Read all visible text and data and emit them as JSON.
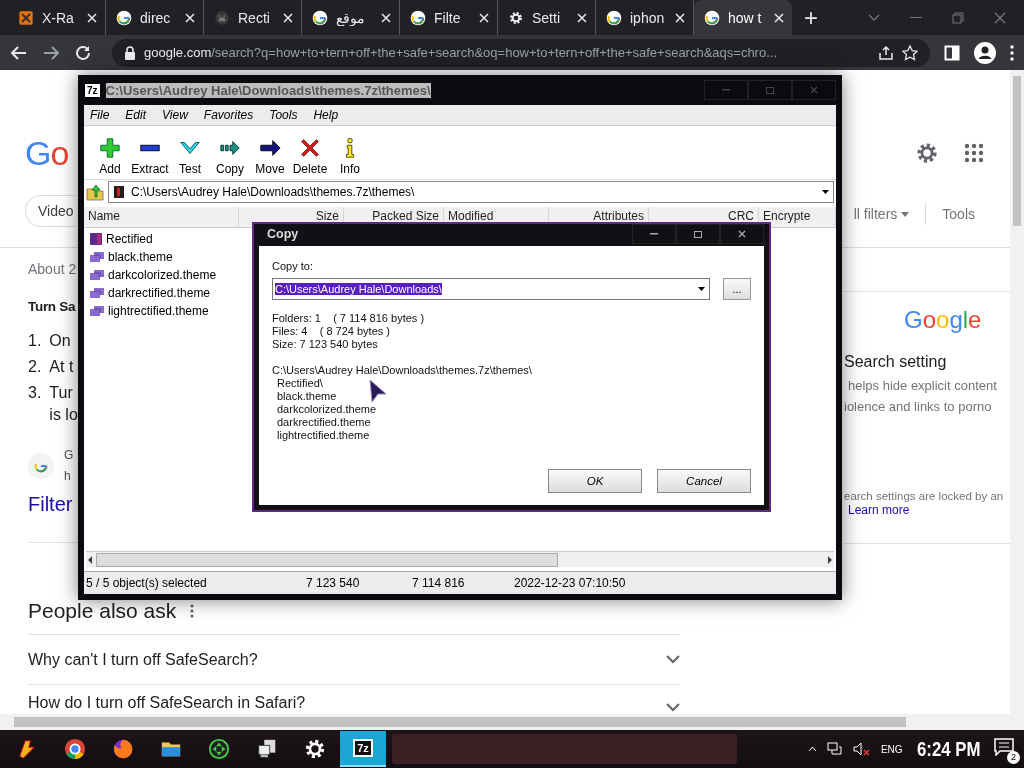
{
  "browser": {
    "tabs": [
      {
        "title": "X-Ra",
        "kind": "xray",
        "selected": false
      },
      {
        "title": "direc",
        "kind": "google",
        "selected": false
      },
      {
        "title": "Recti",
        "kind": "github",
        "selected": false
      },
      {
        "title": "موقع",
        "kind": "google",
        "selected": false
      },
      {
        "title": "Filte",
        "kind": "google",
        "selected": false
      },
      {
        "title": "Setti",
        "kind": "gear",
        "selected": false
      },
      {
        "title": "iphon",
        "kind": "google",
        "selected": false
      },
      {
        "title": "how t",
        "kind": "google",
        "selected": true
      }
    ],
    "new_tab": "+",
    "address": {
      "host": "google.com",
      "path": "/search?q=how+to+tern+off+the+safe+search&oq=how+to+tern+off+the+safe+search&aqs=chro..."
    }
  },
  "page": {
    "logo": "Go",
    "chip": "Video",
    "filters": "ll filters",
    "tools": "Tools",
    "result_count": "About 2",
    "snippet_title": "Turn Sa",
    "steps": [
      {
        "number": "1.",
        "lines": [
          "On"
        ]
      },
      {
        "number": "2.",
        "lines": [
          "At t"
        ]
      },
      {
        "number": "3.",
        "lines": [
          "Tur",
          "is lo"
        ]
      }
    ],
    "source": {
      "name": "G",
      "url": "h"
    },
    "result_link": "Filter",
    "people_also_ask": {
      "title": "People also ask",
      "questions": [
        {
          "text": "Why can't I turn off SafeSearch?",
          "expanded": false
        },
        {
          "text": "How do I turn off SafeSearch in Safari?",
          "expanded": false
        }
      ]
    },
    "panel": {
      "logo": "Google",
      "heading": "Search setting",
      "lines": [
        "helps hide explicit content",
        "iolence and links to porno"
      ],
      "note": "earch settings are locked by an",
      "link": "Learn more"
    }
  },
  "archive_window": {
    "icon_text": "7z",
    "title": {
      "text": "C:\\Users\\Audrey Hale\\Downloads\\themes.7z\\themes\\",
      "selected": true
    },
    "menu": [
      "File",
      "Edit",
      "View",
      "Favorites",
      "Tools",
      "Help"
    ],
    "toolbar": [
      {
        "label": "Add",
        "kind": "add"
      },
      {
        "label": "Extract",
        "kind": "extract"
      },
      {
        "label": "Test",
        "kind": "test"
      },
      {
        "label": "Copy",
        "kind": "copy"
      },
      {
        "label": "Move",
        "kind": "move"
      },
      {
        "label": "Delete",
        "kind": "delete"
      },
      {
        "label": "Info",
        "kind": "info"
      }
    ],
    "path": "C:\\Users\\Audrey Hale\\Downloads\\themes.7z\\themes\\",
    "columns": [
      "Name",
      "Size",
      "Packed Size",
      "Modified",
      "Attributes",
      "CRC",
      "Encrypte"
    ],
    "files": [
      {
        "name": "Rectified",
        "kind": "folder"
      },
      {
        "name": "black.theme",
        "kind": "file"
      },
      {
        "name": "darkcolorized.theme",
        "kind": "file"
      },
      {
        "name": "darkrectified.theme",
        "kind": "file"
      },
      {
        "name": "lightrectified.theme",
        "kind": "file"
      }
    ],
    "status": [
      "5 / 5 object(s) selected",
      "7 123 540",
      "7 114 816",
      "2022-12-23 07:10:50"
    ]
  },
  "copy_dialog": {
    "title": "Copy",
    "label": "Copy to:",
    "destination": {
      "value": "C:\\Users\\Audrey Hale\\Downloads\\",
      "selected": true
    },
    "browse": "...",
    "summary": [
      "Folders: 1    ( 7 114 816 bytes )",
      "Files: 4    ( 8 724 bytes )",
      "Size: 7 123 540 bytes"
    ],
    "source": "C:\\Users\\Audrey Hale\\Downloads\\themes.7z\\themes\\",
    "items": [
      "Rectified\\",
      "black.theme",
      "darkcolorized.theme",
      "darkrectified.theme",
      "lightrectified.theme"
    ],
    "buttons": [
      "OK",
      "Cancel"
    ]
  },
  "taskbar": {
    "apps": [
      {
        "kind": "start",
        "selected": false
      },
      {
        "kind": "chrome",
        "selected": false
      },
      {
        "kind": "firefox",
        "selected": false
      },
      {
        "kind": "folder",
        "selected": false
      },
      {
        "kind": "gamepad",
        "selected": false
      },
      {
        "kind": "network",
        "selected": false
      },
      {
        "kind": "gear",
        "selected": false
      },
      {
        "kind": "sevenzip",
        "label": "7z",
        "selected": true
      }
    ],
    "language": "ENG",
    "time": "6:24 PM",
    "notifications": "2"
  }
}
